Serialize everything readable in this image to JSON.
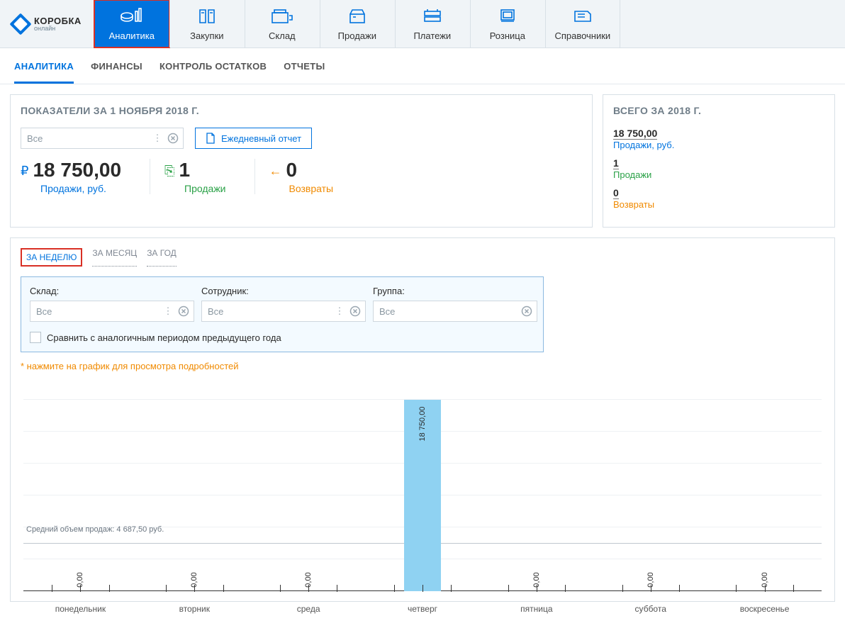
{
  "logo": {
    "name": "КОРОБКА",
    "sub": "онлайн"
  },
  "nav": [
    {
      "label": "Аналитика",
      "active": true
    },
    {
      "label": "Закупки"
    },
    {
      "label": "Склад"
    },
    {
      "label": "Продажи"
    },
    {
      "label": "Платежи"
    },
    {
      "label": "Розница"
    },
    {
      "label": "Справочники"
    }
  ],
  "subtabs": [
    {
      "label": "АНАЛИТИКА",
      "active": true
    },
    {
      "label": "ФИНАНСЫ"
    },
    {
      "label": "КОНТРОЛЬ ОСТАТКОВ"
    },
    {
      "label": "ОТЧЕТЫ"
    }
  ],
  "main_panel": {
    "title": "ПОКАЗАТЕЛИ ЗА 1 НОЯБРЯ 2018 Г.",
    "filter_value": "Все",
    "daily_report_btn": "Ежедневный отчет",
    "metrics": [
      {
        "symbol": "₽",
        "value": "18 750,00",
        "label": "Продажи, руб.",
        "cls": "m-blue"
      },
      {
        "symbol": "⎘",
        "value": "1",
        "label": "Продажи",
        "cls": "m-green"
      },
      {
        "symbol": "←",
        "value": "0",
        "label": "Возвраты",
        "cls": "m-orange"
      }
    ]
  },
  "side_panel": {
    "title": "ВСЕГО ЗА 2018 Г.",
    "rows": [
      {
        "value": "18 750,00",
        "label": "Продажи, руб.",
        "cls": "blue"
      },
      {
        "value": "1",
        "label": "Продажи",
        "cls": "green"
      },
      {
        "value": "0",
        "label": "Возвраты",
        "cls": "orange"
      }
    ]
  },
  "period_tabs": [
    {
      "label": "ЗА НЕДЕЛЮ",
      "active": true
    },
    {
      "label": "ЗА МЕСЯЦ"
    },
    {
      "label": "ЗА ГОД"
    }
  ],
  "filters": {
    "warehouse_label": "Склад:",
    "employee_label": "Сотрудник:",
    "group_label": "Группа:",
    "value_all": "Все",
    "compare_label": "Сравнить с аналогичным периодом предыдущего года"
  },
  "chart_hint": "* нажмите на график для просмотра подробностей",
  "chart_data": {
    "type": "bar",
    "categories": [
      "понедельник",
      "вторник",
      "среда",
      "четверг",
      "пятница",
      "суббота",
      "воскресенье"
    ],
    "values": [
      0,
      0,
      0,
      18750,
      0,
      0,
      0
    ],
    "value_labels": [
      "0,00",
      "0,00",
      "0,00",
      "18 750,00",
      "0,00",
      "0,00",
      "0,00"
    ],
    "avg_label": "Средний объем продаж: 4 687,50 руб.",
    "avg_value": 4687.5,
    "ymax": 18750
  }
}
